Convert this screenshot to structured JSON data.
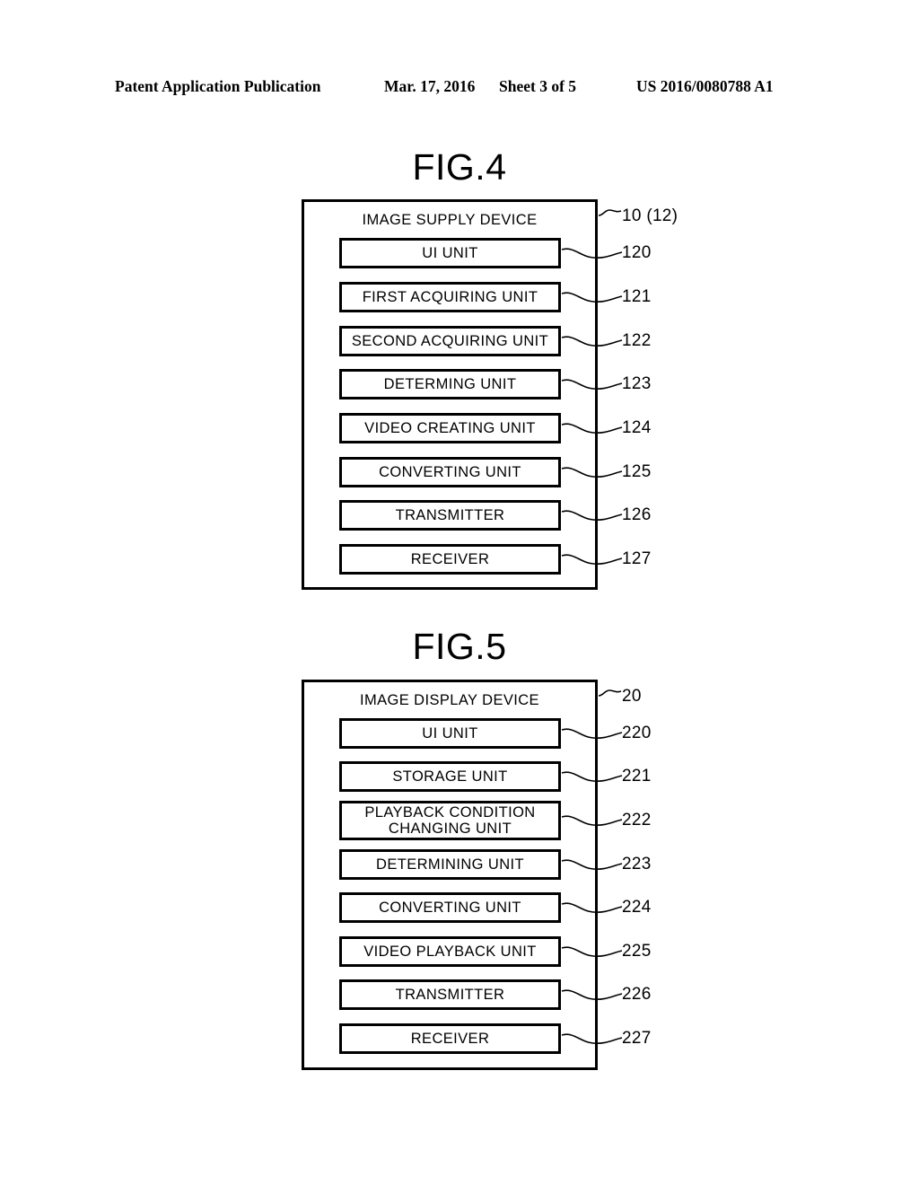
{
  "header": {
    "publication": "Patent Application Publication",
    "date": "Mar. 17, 2016",
    "sheet": "Sheet 3 of 5",
    "patent_number": "US 2016/0080788 A1"
  },
  "figures": [
    {
      "id": "fig4",
      "title": "FIG.4",
      "device_title": "IMAGE SUPPLY DEVICE",
      "device_ref": "10 (12)",
      "units": [
        {
          "label": "UI UNIT",
          "ref": "120"
        },
        {
          "label": "FIRST ACQUIRING UNIT",
          "ref": "121"
        },
        {
          "label": "SECOND ACQUIRING UNIT",
          "ref": "122"
        },
        {
          "label": "DETERMING UNIT",
          "ref": "123"
        },
        {
          "label": "VIDEO CREATING UNIT",
          "ref": "124"
        },
        {
          "label": "CONVERTING UNIT",
          "ref": "125"
        },
        {
          "label": "TRANSMITTER",
          "ref": "126"
        },
        {
          "label": "RECEIVER",
          "ref": "127"
        }
      ]
    },
    {
      "id": "fig5",
      "title": "FIG.5",
      "device_title": "IMAGE DISPLAY DEVICE",
      "device_ref": "20",
      "units": [
        {
          "label": "UI UNIT",
          "ref": "220"
        },
        {
          "label": "STORAGE UNIT",
          "ref": "221"
        },
        {
          "label": "PLAYBACK CONDITION\nCHANGING UNIT",
          "ref": "222"
        },
        {
          "label": "DETERMINING UNIT",
          "ref": "223"
        },
        {
          "label": "CONVERTING UNIT",
          "ref": "224"
        },
        {
          "label": "VIDEO PLAYBACK UNIT",
          "ref": "225"
        },
        {
          "label": "TRANSMITTER",
          "ref": "226"
        },
        {
          "label": "RECEIVER",
          "ref": "227"
        }
      ]
    }
  ],
  "colors": {
    "ink": "#000000",
    "paper": "#ffffff"
  }
}
